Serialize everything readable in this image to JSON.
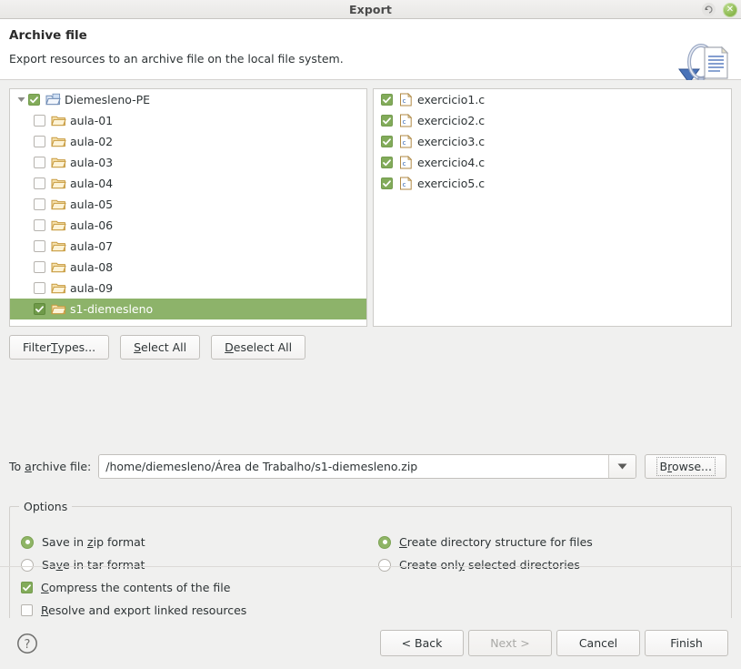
{
  "window": {
    "title": "Export",
    "restore_icon": "restore-icon",
    "close_icon": "close-icon",
    "close_glyph": "✕"
  },
  "header": {
    "title": "Archive file",
    "description": "Export resources to an archive file on the local file system.",
    "banner_icon": "archive-file-wizard-banner-icon"
  },
  "tree": {
    "root": {
      "label": "Diemesleno-PE",
      "checked": true,
      "expanded": true,
      "icon": "open-folder-blue-icon"
    },
    "children": [
      {
        "label": "aula-01",
        "checked": false,
        "selected": false,
        "icon": "folder-icon"
      },
      {
        "label": "aula-02",
        "checked": false,
        "selected": false,
        "icon": "folder-icon"
      },
      {
        "label": "aula-03",
        "checked": false,
        "selected": false,
        "icon": "folder-icon"
      },
      {
        "label": "aula-04",
        "checked": false,
        "selected": false,
        "icon": "folder-icon"
      },
      {
        "label": "aula-05",
        "checked": false,
        "selected": false,
        "icon": "folder-icon"
      },
      {
        "label": "aula-06",
        "checked": false,
        "selected": false,
        "icon": "folder-icon"
      },
      {
        "label": "aula-07",
        "checked": false,
        "selected": false,
        "icon": "folder-icon"
      },
      {
        "label": "aula-08",
        "checked": false,
        "selected": false,
        "icon": "folder-icon"
      },
      {
        "label": "aula-09",
        "checked": false,
        "selected": false,
        "icon": "folder-icon"
      },
      {
        "label": "s1-diemesleno",
        "checked": true,
        "selected": true,
        "icon": "folder-icon"
      }
    ]
  },
  "file_list": [
    {
      "label": "exercicio1.c",
      "checked": true,
      "icon": "c-source-file-icon"
    },
    {
      "label": "exercicio2.c",
      "checked": true,
      "icon": "c-source-file-icon"
    },
    {
      "label": "exercicio3.c",
      "checked": true,
      "icon": "c-source-file-icon"
    },
    {
      "label": "exercicio4.c",
      "checked": true,
      "icon": "c-source-file-icon"
    },
    {
      "label": "exercicio5.c",
      "checked": true,
      "icon": "c-source-file-icon"
    }
  ],
  "filter_buttons": {
    "filter_types": {
      "pre": "Filter ",
      "mnemonic": "T",
      "post": "ypes..."
    },
    "select_all": {
      "pre": "",
      "mnemonic": "S",
      "post": "elect All"
    },
    "deselect_all": {
      "pre": "",
      "mnemonic": "D",
      "post": "eselect All"
    }
  },
  "archive": {
    "label_pre": "To ",
    "label_mnemonic": "a",
    "label_post": "rchive file:",
    "value": "/home/diemesleno/Área de Trabalho/s1-diemesleno.zip",
    "placeholder": "",
    "dropdown_icon": "chevron-down-icon",
    "browse": {
      "pre": "B",
      "mnemonic": "r",
      "post": "owse..."
    }
  },
  "options": {
    "group_title": "Options",
    "left": [
      {
        "type": "radio",
        "selected": true,
        "pre": "Save in ",
        "mnemonic": "z",
        "post": "ip format"
      },
      {
        "type": "radio",
        "selected": false,
        "pre": "Sa",
        "mnemonic": "v",
        "post": "e in tar format"
      },
      {
        "type": "checkbox",
        "selected": true,
        "pre": "",
        "mnemonic": "C",
        "post": "ompress the contents of the file"
      },
      {
        "type": "checkbox",
        "selected": false,
        "pre": "",
        "mnemonic": "R",
        "post": "esolve and export linked resources"
      }
    ],
    "right": [
      {
        "type": "radio",
        "selected": true,
        "pre": "",
        "mnemonic": "C",
        "post": "reate directory structure for files"
      },
      {
        "type": "radio",
        "selected": false,
        "pre": "Create onl",
        "mnemonic": "y",
        "post": " selected directories"
      }
    ]
  },
  "footer": {
    "help_icon": "help-question-icon",
    "back": "< Back",
    "next": "Next >",
    "cancel": "Cancel",
    "finish": "Finish",
    "next_disabled": true
  },
  "colors": {
    "selection_green": "#8db36a",
    "check_green": "#82ab5a",
    "dialog_bg": "#f0f0ef",
    "panel_bg": "#ffffff"
  }
}
